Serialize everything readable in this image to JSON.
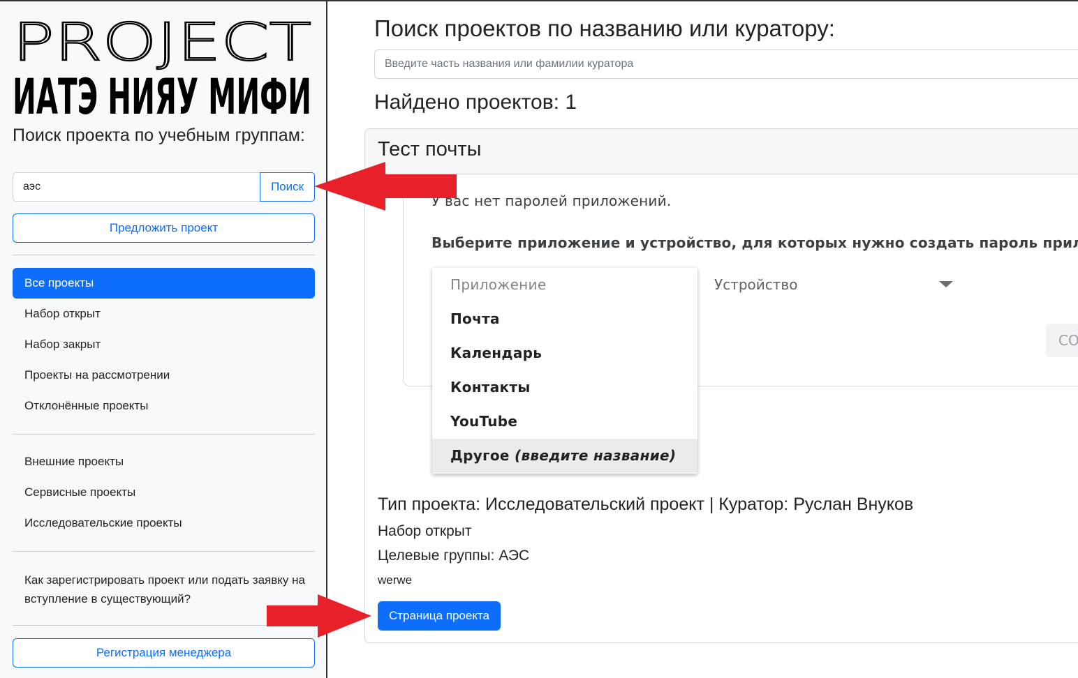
{
  "sidebar": {
    "logo_top": "PROJECT",
    "logo_bottom": "ИАТЭ НИЯУ МИФИ",
    "group_search_title": "Поиск проекта по учебным группам:",
    "group_search_value": "аэс",
    "group_search_button": "Поиск",
    "propose_button": "Предложить проект",
    "status_items": [
      {
        "label": "Все проекты",
        "active": true
      },
      {
        "label": "Набор открыт",
        "active": false
      },
      {
        "label": "Набор закрыт",
        "active": false
      },
      {
        "label": "Проекты на рассмотрении",
        "active": false
      },
      {
        "label": "Отклонённые проекты",
        "active": false
      }
    ],
    "type_items": [
      {
        "label": "Внешние проекты"
      },
      {
        "label": "Сервисные проекты"
      },
      {
        "label": "Исследовательские проекты"
      }
    ],
    "help_text": "Как зарегистрировать проект или подать заявку на вступление в существующий?",
    "manager_button": "Регистрация менеджера"
  },
  "main": {
    "title": "Поиск проектов по названию или куратору:",
    "search_placeholder": "Введите часть названия или фамилии куратора",
    "found_text": "Найдено проектов: 1",
    "card": {
      "title": "Тест почты",
      "embed": {
        "no_passwords": "У вас нет паролей приложений.",
        "select_prompt": "Выберите приложение и устройство, для которых нужно создать пароль прилож",
        "device_label": "Устройство",
        "create_button": "СО",
        "dropdown_placeholder": "Приложение",
        "dropdown_items": [
          "Почта",
          "Календарь",
          "Контакты",
          "YouTube"
        ],
        "dropdown_other": "Другое",
        "dropdown_other_hint": "(введите название)"
      },
      "project_type_line": "Тип проекта: Исследовательский проект | Куратор: Руслан Внуков",
      "recruitment_status": "Набор открыт",
      "target_groups": "Целевые группы: АЭС",
      "description": "werwe",
      "project_page_button": "Страница проекта"
    }
  },
  "colors": {
    "primary": "#0d6efd",
    "annotation_arrow": "#e8202a",
    "sidebar_bg": "#f8f9fa"
  }
}
